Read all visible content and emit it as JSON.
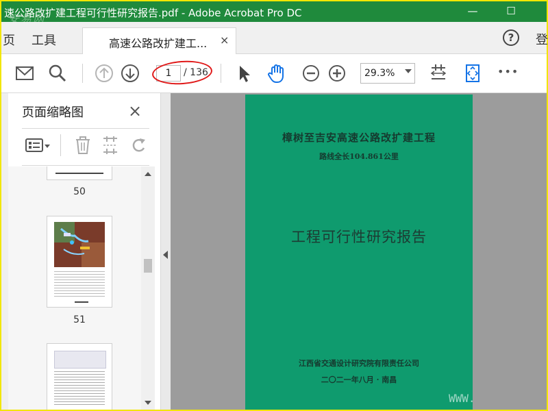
{
  "window": {
    "title": "速公路改扩建工程可行性研究报告.pdf - Adobe Acrobat Pro DC",
    "watermark": "安易网"
  },
  "tabbar": {
    "menu_home": "页",
    "menu_tools": "工具",
    "doc_tab_label": "高速公路改扩建工...",
    "close_glyph": "×",
    "help_glyph": "?",
    "sign_in": "登"
  },
  "toolbar": {
    "current_page": "1",
    "total_pages": "/ 136",
    "zoom": "29.3%",
    "more_glyph": "•••",
    "highlight_color": "#e01818"
  },
  "panel": {
    "title": "页面缩略图",
    "close_glyph": "×",
    "thumbnails": [
      {
        "label": "50"
      },
      {
        "label": "51"
      },
      {
        "label": ""
      }
    ]
  },
  "document": {
    "title_line1": "樟树至吉安高速公路改扩建工程",
    "title_line2": "路线全长104.861公里",
    "main_title": "工程可行性研究报告",
    "organization": "江西省交通设计研究院有限责任公司",
    "date_place": "二〇二一年八月 · 南昌",
    "cover_color": "#0f9b6e"
  },
  "overlay": {
    "site_mark": "WWW."
  },
  "colors": {
    "titlebar": "#1f8a3c",
    "accent_blue": "#1473e6"
  }
}
